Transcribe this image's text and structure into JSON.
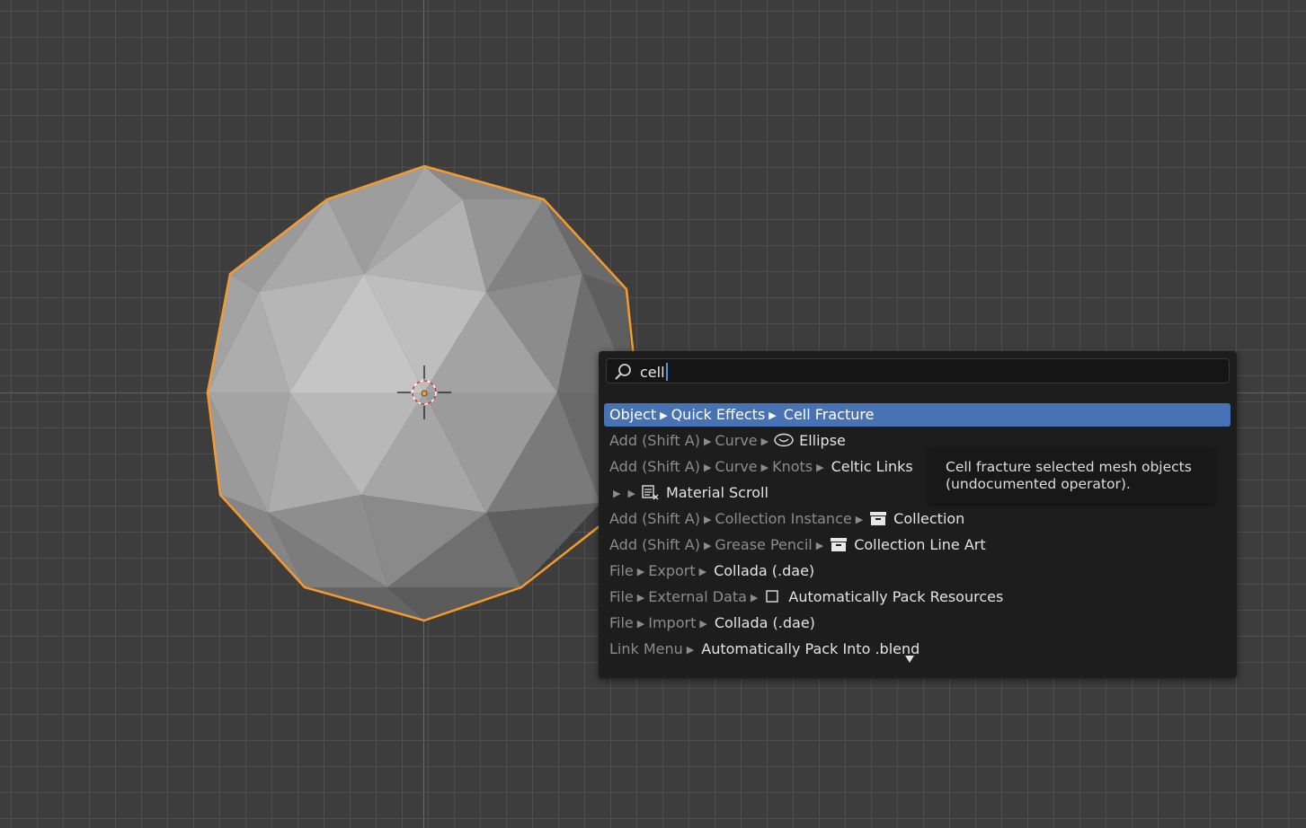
{
  "search": {
    "query": "cell"
  },
  "results": [
    {
      "path": [
        "Object",
        "Quick Effects"
      ],
      "icon": "",
      "label": "Cell Fracture",
      "active": true
    },
    {
      "path": [
        "Add (Shift A)",
        "Curve"
      ],
      "icon": "ellipse-icon",
      "label": "Ellipse"
    },
    {
      "path": [
        "Add (Shift A)",
        "Curve",
        "Knots"
      ],
      "icon": "",
      "label": "Celtic Links"
    },
    {
      "path": [
        "",
        ""
      ],
      "icon": "material-scroll-icon",
      "label": "Material Scroll"
    },
    {
      "path": [
        "Add (Shift A)",
        "Collection Instance"
      ],
      "icon": "collection-box-icon",
      "label": "Collection"
    },
    {
      "path": [
        "Add (Shift A)",
        "Grease Pencil"
      ],
      "icon": "collection-box-icon",
      "label": "Collection Line Art"
    },
    {
      "path": [
        "File",
        "Export"
      ],
      "icon": "",
      "label": "Collada (.dae)"
    },
    {
      "path": [
        "File",
        "External Data"
      ],
      "icon": "checkbox-icon",
      "label": "Automatically Pack Resources"
    },
    {
      "path": [
        "File",
        "Import"
      ],
      "icon": "",
      "label": "Collada (.dae)"
    },
    {
      "path": [
        "Link Menu"
      ],
      "icon": "",
      "label": "Automatically Pack Into .blend"
    }
  ],
  "tooltip": {
    "line1": "Cell fracture selected mesh objects",
    "line2": "(undocumented operator)."
  },
  "colors": {
    "selection_outline": "#f59a2e",
    "highlight": "#4772b3",
    "x_axis": "#a8434a",
    "y_axis": "#3f6fb0"
  }
}
